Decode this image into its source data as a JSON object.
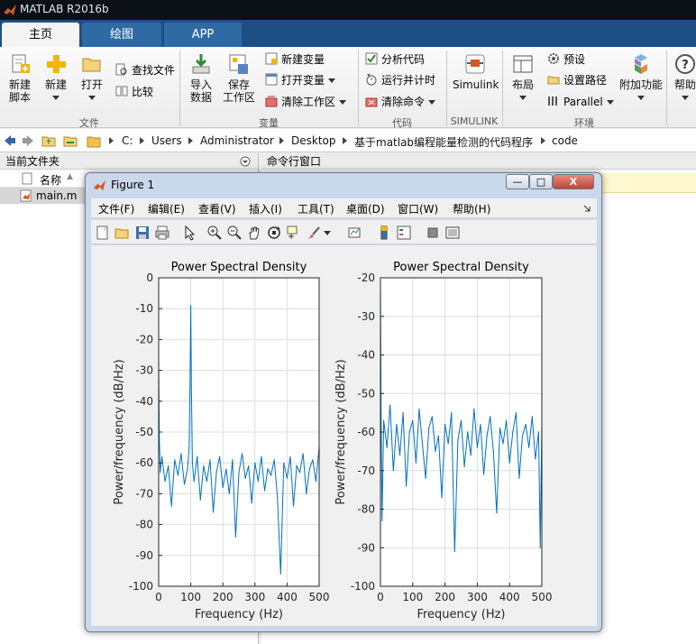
{
  "app": {
    "title": "MATLAB R2016b"
  },
  "tabs": [
    {
      "label": "主页",
      "active": true
    },
    {
      "label": "绘图",
      "active": false
    },
    {
      "label": "APP",
      "active": false
    }
  ],
  "ribbon": {
    "new_script": "新建\n脚本",
    "new": "新建",
    "open": "打开",
    "find_files": "查找文件",
    "compare": "比较",
    "group_file": "文件",
    "import_data": "导入\n数据",
    "save_workspace": "保存\n工作区",
    "new_variable": "新建变量",
    "open_variable": "打开变量",
    "clear_workspace": "清除工作区",
    "group_variable": "变量",
    "analyze_code": "分析代码",
    "run_and_time": "运行并计时",
    "clear_commands": "清除命令",
    "group_code": "代码",
    "simulink": "Simulink",
    "group_simulink": "SIMULINK",
    "layout": "布局",
    "preferences": "预设",
    "set_path": "设置路径",
    "parallel": "Parallel",
    "group_environment": "环境",
    "addons": "附加功能",
    "help": "帮助"
  },
  "address": {
    "crumbs": [
      "C:",
      "Users",
      "Administrator",
      "Desktop",
      "基于matlab编程能量检测的代码程序",
      "code"
    ]
  },
  "file_panel": {
    "title": "当前文件夹",
    "column_name": "名称",
    "sort_indicator": "▲",
    "files": [
      "main.m"
    ]
  },
  "command_panel": {
    "title": "命令行窗口"
  },
  "figure": {
    "title": "Figure 1",
    "menu": [
      "文件(F)",
      "编辑(E)",
      "查看(V)",
      "插入(I)",
      "工具(T)",
      "桌面(D)",
      "窗口(W)",
      "帮助(H)"
    ],
    "window_buttons": {
      "minimize": "—",
      "maximize": "□",
      "close": "X"
    }
  },
  "colors": {
    "line": "#0072bd",
    "ribbon_tab_bar": "#1d4f85",
    "titlebar": "#0b0f16"
  },
  "chart_data": [
    {
      "type": "line",
      "title": "Power Spectral Density",
      "xlabel": "Frequency (Hz)",
      "ylabel": "Power/frequency (dB/Hz)",
      "xlim": [
        0,
        500
      ],
      "ylim": [
        -100,
        0
      ],
      "xticks": [
        0,
        100,
        200,
        300,
        400,
        500
      ],
      "yticks": [
        0,
        -10,
        -20,
        -30,
        -40,
        -50,
        -60,
        -70,
        -80,
        -90,
        -100
      ],
      "grid": true,
      "series": [
        {
          "x": [
            0,
            2,
            5,
            10,
            20,
            30,
            40,
            50,
            60,
            70,
            80,
            90,
            95,
            98,
            100,
            102,
            105,
            110,
            120,
            130,
            140,
            150,
            160,
            170,
            180,
            190,
            200,
            210,
            220,
            230,
            240,
            250,
            260,
            270,
            280,
            290,
            300,
            310,
            320,
            330,
            340,
            350,
            360,
            370,
            380,
            390,
            400,
            410,
            420,
            430,
            440,
            450,
            460,
            470,
            480,
            490,
            500
          ],
          "y": [
            -28,
            -52,
            -63,
            -58,
            -66,
            -61,
            -74,
            -59,
            -64,
            -57,
            -67,
            -62,
            -55,
            -30,
            -9,
            -35,
            -60,
            -66,
            -58,
            -72,
            -61,
            -66,
            -59,
            -76,
            -63,
            -58,
            -68,
            -62,
            -70,
            -59,
            -84,
            -63,
            -57,
            -65,
            -61,
            -73,
            -60,
            -66,
            -58,
            -69,
            -62,
            -64,
            -59,
            -71,
            -96,
            -60,
            -65,
            -58,
            -74,
            -61,
            -63,
            -57,
            -70,
            -62,
            -59,
            -66,
            -55
          ]
        }
      ]
    },
    {
      "type": "line",
      "title": "Power Spectral Density",
      "xlabel": "Frequency (Hz)",
      "ylabel": "Power/frequency (dB/Hz)",
      "xlim": [
        0,
        500
      ],
      "ylim": [
        -100,
        -20
      ],
      "xticks": [
        0,
        100,
        200,
        300,
        400,
        500
      ],
      "yticks": [
        -20,
        -30,
        -40,
        -50,
        -60,
        -70,
        -80,
        -90,
        -100
      ],
      "grid": true,
      "series": [
        {
          "x": [
            0,
            2,
            5,
            10,
            20,
            30,
            40,
            50,
            60,
            70,
            80,
            90,
            100,
            110,
            120,
            130,
            140,
            150,
            160,
            170,
            180,
            190,
            200,
            210,
            220,
            230,
            240,
            250,
            260,
            270,
            280,
            290,
            300,
            310,
            320,
            330,
            340,
            350,
            360,
            370,
            380,
            390,
            400,
            410,
            420,
            430,
            440,
            450,
            460,
            470,
            480,
            490,
            495,
            500
          ],
          "y": [
            -22,
            -55,
            -83,
            -57,
            -64,
            -53,
            -70,
            -58,
            -66,
            -55,
            -74,
            -60,
            -57,
            -68,
            -54,
            -63,
            -72,
            -59,
            -56,
            -65,
            -61,
            -77,
            -58,
            -63,
            -55,
            -91,
            -62,
            -57,
            -69,
            -60,
            -66,
            -54,
            -64,
            -58,
            -71,
            -61,
            -56,
            -65,
            -81,
            -59,
            -63,
            -57,
            -68,
            -60,
            -55,
            -72,
            -61,
            -58,
            -64,
            -56,
            -67,
            -60,
            -90,
            -58
          ]
        }
      ]
    }
  ]
}
